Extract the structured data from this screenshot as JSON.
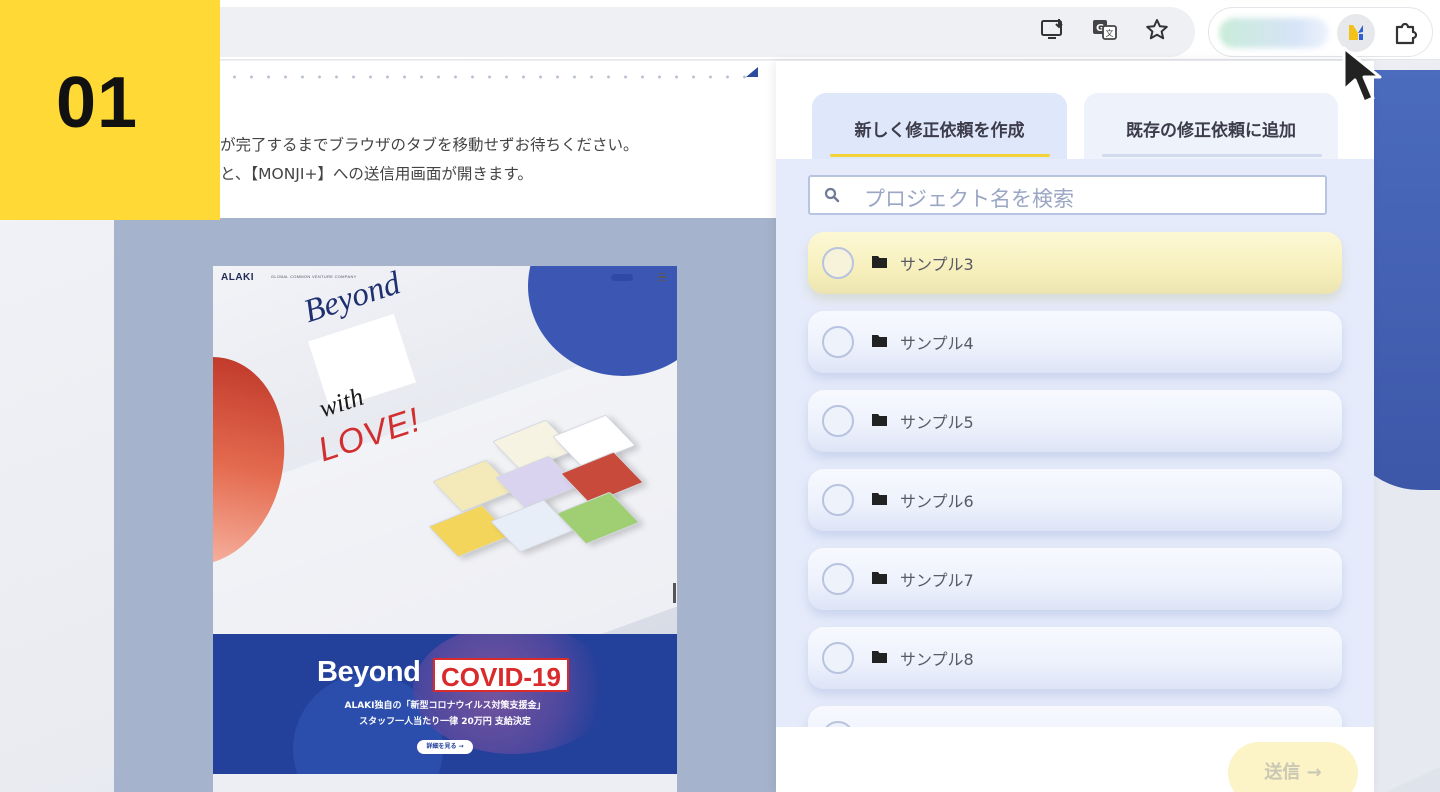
{
  "step_badge": {
    "number": "01"
  },
  "toolbar": {
    "icons": [
      "install-app-icon",
      "translate-icon",
      "bookmark-star-icon",
      "monji-extension-icon",
      "extensions-puzzle-icon"
    ]
  },
  "page": {
    "instructions": [
      "が完了するまでブラウザのタブを移動せずお待ちください。",
      "と、【MONJI+】への送信用画面が開きます。"
    ],
    "site": {
      "logo": "ALAKI",
      "logo_sub": "GLOBAL COMMON VENTURE COMPANY",
      "hero_word1": "Beyond",
      "hero_word2": "with",
      "hero_word3": "LOVE!",
      "covid_title": "Beyond",
      "covid_tag": "COVID-19",
      "covid_line1": "ALAKI独自の「新型コロナウイルス対策支援金」",
      "covid_line2": "スタッフ一人当たり一律 20万円 支給決定",
      "covid_button": "詳細を見る →"
    }
  },
  "popup": {
    "tabs": [
      {
        "label": "新しく修正依頼を作成",
        "active": true
      },
      {
        "label": "既存の修正依頼に追加",
        "active": false
      }
    ],
    "search": {
      "placeholder": "プロジェクト名を検索"
    },
    "projects": [
      {
        "label": "サンプル3",
        "selected": true
      },
      {
        "label": "サンプル4",
        "selected": false
      },
      {
        "label": "サンプル5",
        "selected": false
      },
      {
        "label": "サンプル6",
        "selected": false
      },
      {
        "label": "サンプル7",
        "selected": false
      },
      {
        "label": "サンプル8",
        "selected": false
      }
    ],
    "send_button": "送信 →"
  },
  "colors": {
    "badge": "#ffd935",
    "accent_blue": "#23409a",
    "selected_item": "#f7f0bd",
    "tab_underline_active": "#f3d23a"
  }
}
